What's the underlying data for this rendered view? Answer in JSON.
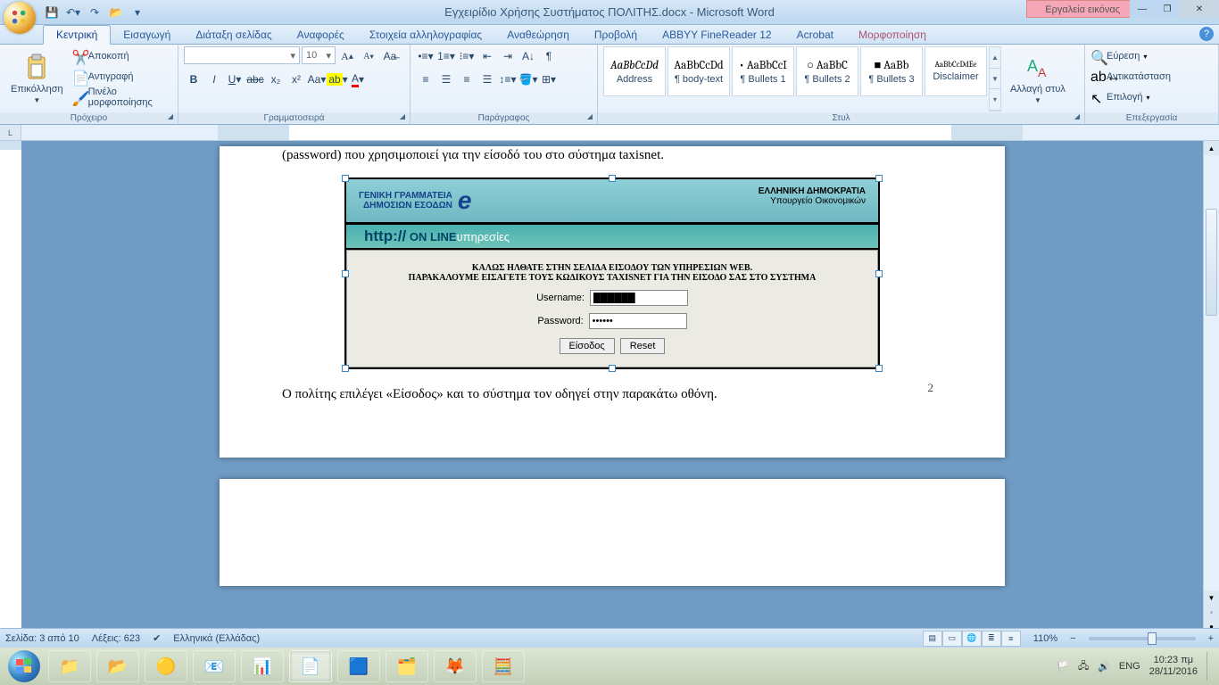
{
  "title": "Εγχειρίδιο Χρήσης Συστήματος ΠΟΛΙΤΗΣ.docx - Microsoft Word",
  "contextual_tab": "Εργαλεία εικόνας",
  "qat": {
    "save": "save-icon",
    "undo": "undo-icon",
    "redo": "redo-icon",
    "open": "open-icon"
  },
  "tabs": [
    "Κεντρική",
    "Εισαγωγή",
    "Διάταξη σελίδας",
    "Αναφορές",
    "Στοιχεία αλληλογραφίας",
    "Αναθεώρηση",
    "Προβολή",
    "ABBYY FineReader 12",
    "Acrobat",
    "Μορφοποίηση"
  ],
  "active_tab": 0,
  "ribbon": {
    "clipboard": {
      "paste": "Επικόλληση",
      "cut": "Αποκοπή",
      "copy": "Αντιγραφή",
      "fmtpainter": "Πινέλο μορφοποίησης",
      "label": "Πρόχειρο"
    },
    "font": {
      "family": "",
      "size": "10",
      "label": "Γραμματοσειρά"
    },
    "para": {
      "label": "Παράγραφος"
    },
    "styles": {
      "label": "Στυλ",
      "items": [
        {
          "prev": "AaBbCcDd",
          "name": "Address"
        },
        {
          "prev": "AaBbCcDd",
          "name": "¶ body-text"
        },
        {
          "prev": "• AaBbCcI",
          "name": "¶ Bullets 1"
        },
        {
          "prev": "○  AaBbC",
          "name": "¶ Bullets 2"
        },
        {
          "prev": "■  AaBb",
          "name": "¶ Bullets 3"
        },
        {
          "prev": "AaBbCcDdEe",
          "name": "Disclaimer"
        }
      ],
      "change": "Αλλαγή στυλ"
    },
    "editing": {
      "find": "Εύρεση",
      "replace": "Αντικατάσταση",
      "select": "Επιλογή",
      "label": "Επεξεργασία"
    }
  },
  "ruler_corner": "L",
  "document": {
    "para1": "(password) που χρησιμοποιεί για την είσοδό του στο σύστημα taxisnet.",
    "para2": "Ο πολίτης επιλέγει «Είσοδος» και το σύστημα τον οδηγεί στην παρακάτω οθόνη.",
    "page_number": "2",
    "embed": {
      "left1": "ΓΕΝΙΚΗ ΓΡΑΜΜΑΤΕΙΑ",
      "left2": "ΔΗΜΟΣΙΩΝ ΕΣΟΔΩΝ",
      "right1": "ΕΛΛΗΝΙΚΗ ΔΗΜΟΚΡΑΤΙΑ",
      "right2": "Υπουργείο Οικονομικών",
      "banner_pre": "http://",
      "banner_bold": "ON LINE",
      "banner_rest": " υπηρεσίες",
      "hd1": "ΚΑΛΩΣ ΗΛΘΑΤΕ ΣΤΗΝ ΣΕΛΙΔΑ ΕΙΣΟΔΟΥ ΤΩΝ ΥΠΗΡΕΣΙΩΝ WEB.",
      "hd2": "ΠΑΡΑΚΑΛΟΥΜΕ ΕΙΣΑΓΕΤΕ ΤΟΥΣ ΚΩΔΙΚΟΥΣ TAXISNET ΓΙΑ ΤΗΝ ΕΙΣΟΔΟ ΣΑΣ ΣΤΟ ΣΥΣΤΗΜΑ",
      "user_lbl": "Username:",
      "user_val": "██████",
      "pass_lbl": "Password:",
      "pass_val": "••••••",
      "btn_login": "Είσοδος",
      "btn_reset": "Reset"
    }
  },
  "status": {
    "page": "Σελίδα: 3 από 10",
    "words": "Λέξεις: 623",
    "lang": "Ελληνικά (Ελλάδας)",
    "zoom": "110%"
  },
  "tray": {
    "lang": "ENG",
    "time": "10:23 πμ",
    "date": "28/11/2016"
  }
}
